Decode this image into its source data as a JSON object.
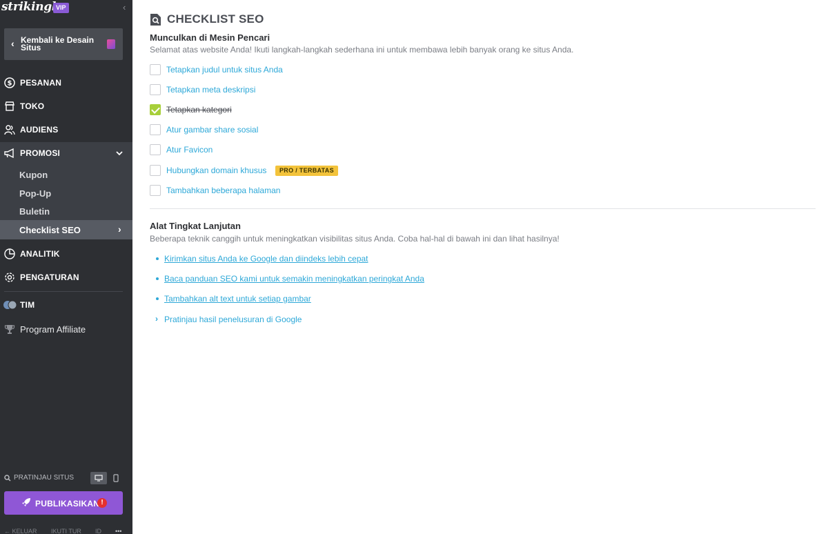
{
  "sidebar": {
    "logo": "strikingly",
    "vip_badge": "VIP",
    "back_button": "Kembali ke Desain Situs",
    "nav": {
      "orders": "PESANAN",
      "store": "TOKO",
      "audience": "AUDIENS",
      "promotion": "PROMOSI",
      "analytics": "ANALITIK",
      "settings": "PENGATURAN",
      "team": "TIM",
      "affiliate": "Program Affiliate"
    },
    "promo_sub": [
      "Kupon",
      "Pop-Up",
      "Buletin",
      "Checklist SEO"
    ],
    "preview_label": "PRATINJAU SITUS",
    "publish_button": "PUBLIKASIKAN",
    "publish_alert": "!",
    "footer": {
      "exit": "KELUAR",
      "tour": "IKUTI TUR",
      "lang": "ID",
      "more": "•••"
    }
  },
  "main": {
    "title": "CHECKLIST SEO",
    "section1": {
      "title": "Munculkan di Mesin Pencari",
      "desc": "Selamat atas website Anda! Ikuti langkah-langkah sederhana ini untuk membawa lebih banyak orang ke situs Anda."
    },
    "checklist": [
      {
        "label": "Tetapkan judul untuk situs Anda",
        "checked": false
      },
      {
        "label": "Tetapkan meta deskripsi",
        "checked": false
      },
      {
        "label": "Tetapkan kategori",
        "checked": true
      },
      {
        "label": "Atur gambar share sosial",
        "checked": false
      },
      {
        "label": "Atur Favicon",
        "checked": false
      },
      {
        "label": "Hubungkan domain khusus",
        "checked": false,
        "badge": "PRO / TERBATAS"
      },
      {
        "label": "Tambahkan beberapa halaman",
        "checked": false
      }
    ],
    "section2": {
      "title": "Alat Tingkat Lanjutan",
      "desc": "Beberapa teknik canggih untuk meningkatkan visibilitas situs Anda. Coba hal-hal di bawah ini dan lihat hasilnya!"
    },
    "links": [
      "Kirimkan situs Anda ke Google dan diindeks lebih cepat",
      "Baca panduan SEO kami untuk semakin meningkatkan peringkat Anda",
      "Tambahkan alt text untuk setiap gambar"
    ],
    "expand_link": "Pratinjau hasil penelusuran di Google"
  },
  "colors": {
    "sidebar_bg": "#2d2f33",
    "accent_link": "#2da8d8",
    "publish": "#8f57d6",
    "check_done": "#a7cf3a",
    "badge": "#f3c33b"
  }
}
